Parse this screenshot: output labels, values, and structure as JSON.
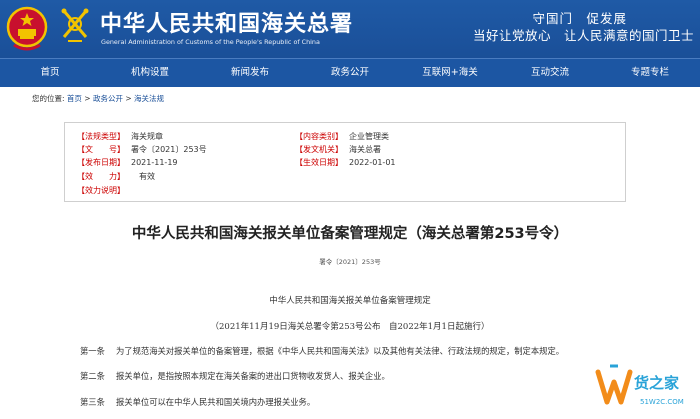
{
  "header": {
    "title": "中华人民共和国海关总署",
    "subtitle": "General Administration of Customs of the People's Republic of China",
    "slogan_line1": "守国门　促发展",
    "slogan_line2": "当好让党放心　让人民满意的国门卫士"
  },
  "nav": [
    "首页",
    "机构设置",
    "新闻发布",
    "政务公开",
    "互联网+海关",
    "互动交流",
    "专题专栏"
  ],
  "breadcrumb": {
    "prefix": "您的位置:",
    "home": "首页",
    "sep": " > ",
    "l2": "政务公开",
    "l3": "海关法规"
  },
  "meta": {
    "category_label": "【法规类型】",
    "category_value": "海关规章",
    "content_label": "【内容类别】",
    "content_value": "企业管理类",
    "docno_label": "【文　　号】",
    "docno_value": "署令〔2021〕253号",
    "issuer_label": "【发文机关】",
    "issuer_value": "海关总署",
    "pubdate_label": "【发布日期】",
    "pubdate_value": "2021-11-19",
    "effdate_label": "【生效日期】",
    "effdate_value": "2022-01-01",
    "validity_label": "【效　　力】",
    "validity_value": "有效",
    "note_label": "【效力说明】"
  },
  "doc": {
    "title": "中华人民共和国海关报关单位备案管理规定（海关总署第253号令）",
    "number": "署令〔2021〕253号",
    "rule_title": "中华人民共和国海关报关单位备案管理规定",
    "rule_date": "（2021年11月19日海关总署令第253号公布　自2022年1月1日起施行）",
    "articles": [
      {
        "num": "第一条",
        "text": "为了规范海关对报关单位的备案管理，根据《中华人民共和国海关法》以及其他有关法律、行政法规的规定，制定本规定。"
      },
      {
        "num": "第二条",
        "text": "报关单位，是指按照本规定在海关备案的进出口货物收发货人、报关企业。"
      },
      {
        "num": "第三条",
        "text": "报关单位可以在中华人民共和国关境内办理报关业务。"
      }
    ]
  },
  "watermark": {
    "brand_cn": "货之家",
    "brand_url": "51W2C.COM"
  }
}
